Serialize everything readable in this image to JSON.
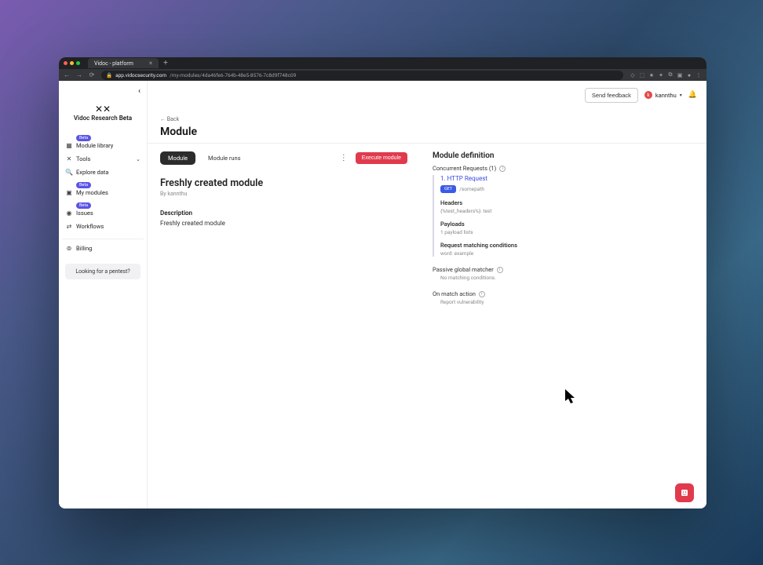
{
  "browser": {
    "tab_title": "Vidoc - platform",
    "url_host": "app.vidocsecurity.com",
    "url_path": "/my-modules/4da46fe6-764b-48e5-8576-7c8d9f748c09"
  },
  "brand": {
    "name": "Vidoc Research",
    "suffix": "Beta"
  },
  "sidebar": {
    "items": [
      {
        "icon": "▦",
        "label": "Module library",
        "badge": "Beta"
      },
      {
        "icon": "✕",
        "label": "Tools",
        "has_chevron": true
      },
      {
        "icon": "🔍",
        "label": "Explore data"
      },
      {
        "icon": "▣",
        "label": "My modules",
        "badge": "Beta"
      },
      {
        "icon": "◉",
        "label": "Issues",
        "badge": "Beta"
      },
      {
        "icon": "⇄",
        "label": "Workflows"
      }
    ],
    "billing": {
      "icon": "⊚",
      "label": "Billing"
    },
    "pentest": "Looking for a pentest?"
  },
  "topbar": {
    "feedback": "Send feedback",
    "user_initial": "k",
    "user_name": "kannthu"
  },
  "breadcrumb": {
    "back": "←  Back"
  },
  "page": {
    "title": "Module"
  },
  "tabs": {
    "module": "Module",
    "runs": "Module runs",
    "execute": "Execute module"
  },
  "module": {
    "name": "Freshly created module",
    "byline": "By kannthu",
    "desc_label": "Description",
    "desc_text": "Freshly created module"
  },
  "definition": {
    "title": "Module definition",
    "concurrent_label": "Concurrent Requests (1)",
    "request": {
      "title": "1. HTTP Request",
      "method": "GET",
      "path": "/somepath",
      "headers_label": "Headers",
      "headers_value": "{%test_headers%}: test",
      "payloads_label": "Payloads",
      "payloads_value": "1 payload lists",
      "conditions_label": "Request matching conditions",
      "conditions_value": "word: example"
    },
    "passive": {
      "label": "Passive global matcher",
      "value": "No matching conditions."
    },
    "action": {
      "label": "On match action",
      "value": "Report vulnerability"
    }
  }
}
